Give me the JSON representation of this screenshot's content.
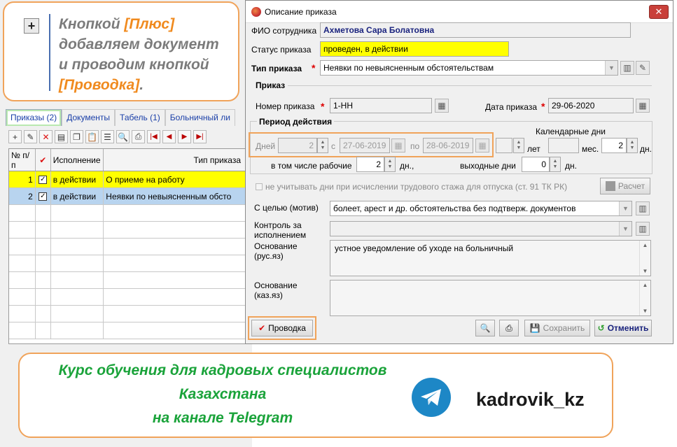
{
  "callout": {
    "plus": "+",
    "line1_a": "Кнопкой ",
    "line1_b": "[Плюс]",
    "line2": "добавляем документ",
    "line3": "и проводим кнопкой",
    "line4_a": "[Проводка]",
    "line4_b": "."
  },
  "left_app": {
    "tabs": [
      "Приказы (2)",
      "Документы",
      "Табель (1)",
      "Больничный ли"
    ],
    "columns": [
      "№ п/п",
      "✔",
      "Исполнение",
      "Тип приказа"
    ],
    "rows": [
      {
        "num": "1",
        "checked": "✓",
        "status": "в действии",
        "type": "О приеме на работу"
      },
      {
        "num": "2",
        "checked": "✓",
        "status": "в действии",
        "type": "Неявки по невыясненным обсто"
      }
    ]
  },
  "dialog": {
    "title": "Описание приказа",
    "close": "✕",
    "fio_label": "ФИО сотрудника",
    "fio_value": "Ахметова Сара Болатовна",
    "status_label": "Статус приказа",
    "status_value": "проведен, в действии",
    "type_label": "Тип приказа",
    "type_value": "Неявки по невыясненным обстоятельствам",
    "order_group": "Приказ",
    "number_label": "Номер приказа",
    "number_value": "1-НН",
    "date_label": "Дата приказа",
    "date_value": "29-06-2020",
    "period_group": "Период действия",
    "calendar_days_label": "Календарные дни",
    "days_label": "Дней",
    "days_value": "2",
    "from_label": "с",
    "from_value": "27-06-2019",
    "to_label": "по",
    "to_value": "28-06-2019",
    "years_label": "лет",
    "months_label": "мес.",
    "cal_days_value": "2",
    "cal_days_unit": "дн.",
    "work_days_label": "в том числе рабочие",
    "work_days_value": "2",
    "work_days_unit": "дн.,",
    "weekend_label": "выходные дни",
    "weekend_value": "0",
    "weekend_unit": "дн.",
    "exclude_checkbox": "не учитывать дни при исчислении трудового стажа для отпуска (ст. 91 ТК РК)",
    "calc_button": "Расчет",
    "purpose_label": "С целью (мотив)",
    "purpose_value": "болеет, арест и др. обстоятельства без подтверж. документов",
    "control_label": "Контроль за исполнением",
    "basis_ru_label": "Основание (рус.яз)",
    "basis_ru_value": "устное уведомление об уходе на больничный",
    "basis_kz_label": "Основание (каз.яз)",
    "basis_kz_value": "",
    "post_button": "Проводка",
    "save_button": "Сохранить",
    "cancel_button": "Отменить"
  },
  "banner": {
    "line1": "Курс обучения для кадровых специалистов",
    "line2": "Казахстана",
    "line3": "на канале Telegram",
    "channel": "kadrovik_kz"
  },
  "colors": {
    "accent_orange": "#f0a35a",
    "callout_highlight": "#f08a1e",
    "banner_green": "#1aa33a",
    "telegram_blue": "#1d87c6",
    "status_yellow": "#ffff00",
    "name_navy": "#1a237e"
  }
}
